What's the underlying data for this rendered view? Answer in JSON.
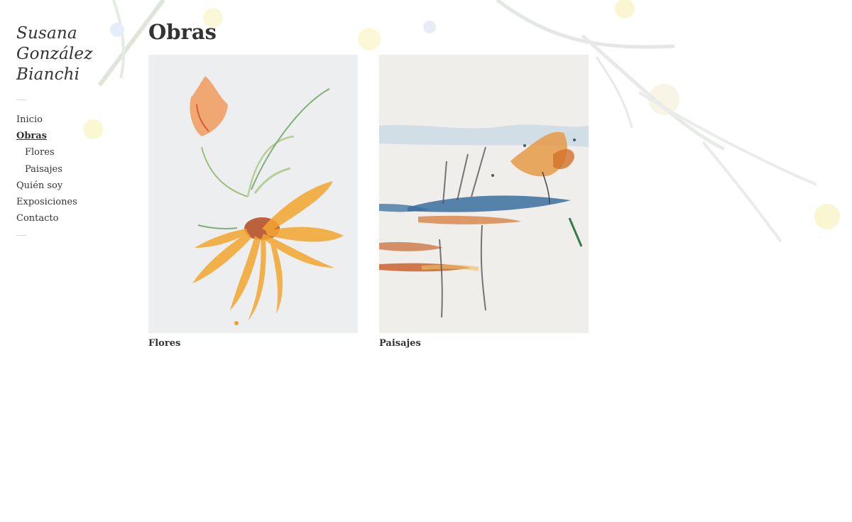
{
  "site": {
    "title_lines": [
      "Susana",
      "González",
      "Bianchi"
    ]
  },
  "nav": {
    "items": [
      {
        "label": "Inicio"
      },
      {
        "label": "Obras"
      },
      {
        "label": "Flores"
      },
      {
        "label": "Paisajes"
      },
      {
        "label": "Quién soy"
      },
      {
        "label": "Exposiciones"
      },
      {
        "label": "Contacto"
      }
    ],
    "current": "Obras"
  },
  "main": {
    "title": "Obras",
    "gallery": [
      {
        "caption": "Flores",
        "image": "watercolor-flowers"
      },
      {
        "caption": "Paisajes",
        "image": "watercolor-landscape"
      }
    ]
  },
  "colors": {
    "text": "#333333",
    "background": "#ffffff",
    "accent_orange": "#f0a22a",
    "accent_blue": "#3a6ea0"
  }
}
